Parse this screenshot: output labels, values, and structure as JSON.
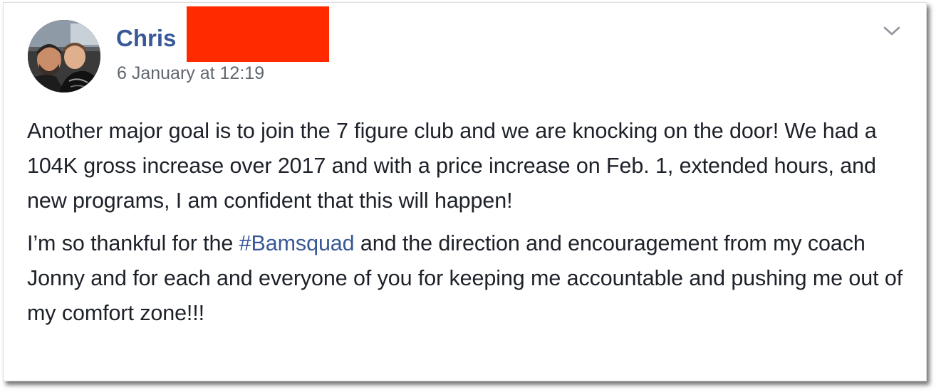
{
  "post": {
    "author_name": "Chris",
    "timestamp": "6 January at 12:19",
    "paragraph_1": "Another major goal is to join the 7 figure club and we are knocking on the door! We had a 104K gross increase over 2017 and with a price increase on Feb. 1, extended hours, and new programs, I am confident that this will happen!",
    "paragraph_2_before": "I’m so thankful for the ",
    "hashtag": "#Bamsquad",
    "paragraph_2_after": " and the direction and encouragement from my coach Jonny and for each and everyone of you for keeping me accountable and pushing me out of my comfort zone!!!"
  },
  "icons": {
    "menu": "chevron-down-icon",
    "avatar": "profile-photo"
  },
  "colors": {
    "link_blue": "#385898",
    "text": "#1d2129",
    "meta_gray": "#616770",
    "redaction_red": "#ff2a00",
    "border": "#dddfe2"
  }
}
